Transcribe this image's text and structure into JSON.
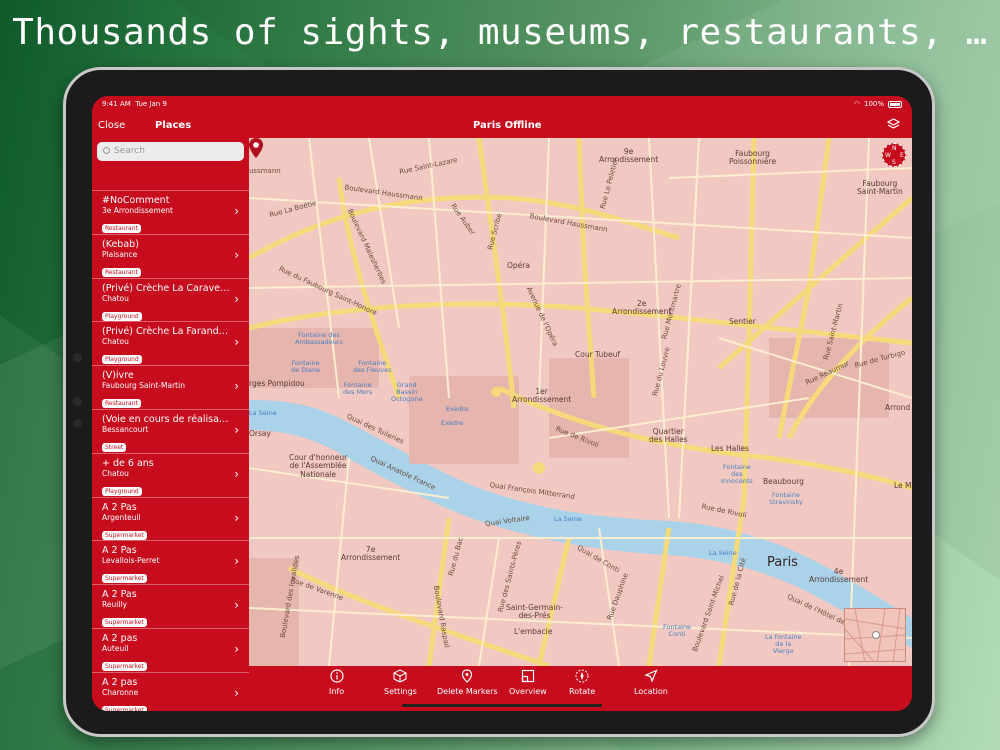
{
  "headline": "Thousands of sights, museums, restaurants, …",
  "status": {
    "time": "9:41 AM",
    "date": "Tue Jan 9",
    "battery": "100%"
  },
  "navbar": {
    "close": "Close",
    "places": "Places",
    "title": "Paris Offline"
  },
  "search": {
    "placeholder": "Search"
  },
  "places": [
    {
      "name": "#NoComment",
      "location": "3e Arrondissement",
      "tag": "Restaurant"
    },
    {
      "name": "(Kebab)",
      "location": "Plaisance",
      "tag": "Restaurant"
    },
    {
      "name": "(Privé) Crèche La Caravelle",
      "location": "Chatou",
      "tag": "Playground"
    },
    {
      "name": "(Privé) Crèche La Farand…",
      "location": "Chatou",
      "tag": "Playground"
    },
    {
      "name": "(V)ivre",
      "location": "Faubourg Saint-Martin",
      "tag": "Restaurant"
    },
    {
      "name": "(Voie en cours de réalisati…",
      "location": "Bessancourt",
      "tag": "Street"
    },
    {
      "name": "+ de 6 ans",
      "location": "Chatou",
      "tag": "Playground"
    },
    {
      "name": "A 2 Pas",
      "location": "Argenteuil",
      "tag": "Supermarket"
    },
    {
      "name": "A 2 Pas",
      "location": "Levallois-Perret",
      "tag": "Supermarket"
    },
    {
      "name": "A 2 Pas",
      "location": "Reuilly",
      "tag": "Supermarket"
    },
    {
      "name": "A 2 pas",
      "location": "Auteuil",
      "tag": "Supermarket"
    },
    {
      "name": "A 2 pas",
      "location": "Charonne",
      "tag": "Supermarket"
    }
  ],
  "map": {
    "labels": {
      "arr9": "9e\nArrondissement",
      "faubourg_poissonniere": "Faubourg\nPoissonnière",
      "faubourg_saint_martin": "Faubourg\nSaint-Martin",
      "opera": "Opéra",
      "arr2": "2e\nArrondissement",
      "sentier": "Sentier",
      "cour_tubeuf": "Cour Tubeuf",
      "arr1": "1er\nArrondissement",
      "quartier_halles": "Quartier\ndes Halles",
      "les_halles": "Les Halles",
      "beaubourg": "Beaubourg",
      "cour_honneur": "Cour d'honneur\nde l'Assemblée\nNationale",
      "arr7": "7e\nArrondissement",
      "saint_germain": "Saint-Germain-\ndes-Prés",
      "paris": "Paris",
      "arr4": "4e\nArrondissement",
      "lembacie": "L'embacie",
      "arrond": "Arrond",
      "le_m": "Le M",
      "orsay": "Orsay",
      "georges_pompidou": "rges Pompidou",
      "fontaine_ambassadeurs": "Fontaine des\nAmbassadeurs",
      "fontaine_diane": "Fontaine\nde Diane",
      "fontaine_fleuves": "Fontaine\ndes Fleuves",
      "fontaine_mers": "Fontaine\ndes Mers",
      "grand_bassin": "Grand\nBassin\nOctogone",
      "exedre1": "Exèdre",
      "exedre2": "Exèdre",
      "fontaine_innocents": "Fontaine\ndes\nInnocents",
      "fontaine_stravinsky": "Fontaine\nStravinsky",
      "fontaine_conti": "Fontaine\nConti",
      "fontaine_vierge": "La fontaine\nde la\nVierge",
      "seine1": "La Seine",
      "seine2": "La Seine",
      "seine3": "La Seine",
      "r_lazare": "Rue Saint-Lazare",
      "r_boetie": "Rue La Boétie",
      "b_haussmann": "Boulevard Haussmann",
      "b_haussmann2": "Boulevard Haussmann",
      "r_rivoli": "Rue de Rivoli",
      "r_rivoli2": "Rue de Rivoli",
      "r_tuileries": "Quai des Tuileries",
      "q_mitterrand": "Quai François Mitterrand",
      "q_voltaire": "Quai Voltaire",
      "q_conti": "Quai de Conti",
      "q_anatole": "Quai Anatole France",
      "r_varenne": "Rue de Varenne",
      "b_raspail": "Boulevard Raspail",
      "b_invalides": "Boulevard des Invalides",
      "r_turbigo": "Rue de Turbigo",
      "r_reaumur": "Rue Réaumur",
      "r_dauphine": "Rue Dauphine",
      "b_saint_michel": "Boulevard Saint-Michel",
      "r_saint_martin": "Rue Saint-Martin",
      "r_du_louvre": "Rue du Louvre",
      "r_faubourg_sh": "Rue du Faubourg Saint-Honoré",
      "av_opera": "Avenue de l'Opéra",
      "r_bac": "Rue du Bac",
      "b_malesherbes": "Boulevard Malesherbes",
      "r_auber": "Rue Auber",
      "r_scribe": "Rue Scribe",
      "r_peletier": "Rue Le Peletier",
      "r_st_peres": "Rue des Saints-Pères",
      "q_hotel_ville": "Quai de l'Hôtel de V",
      "r_montmartre": "Rue Montmartre",
      "r_cite": "Rue de la Cité",
      "haussmann_left": "ussmann"
    }
  },
  "toolbar": [
    {
      "label": "Info",
      "icon": "info-icon"
    },
    {
      "label": "Settings",
      "icon": "cube-icon"
    },
    {
      "label": "Delete Markers",
      "icon": "marker-icon"
    },
    {
      "label": "Overview",
      "icon": "overview-icon"
    },
    {
      "label": "Rotate",
      "icon": "rotate-icon"
    },
    {
      "label": "Location",
      "icon": "location-arrow-icon"
    }
  ],
  "colors": {
    "brand_red": "#c70c1e",
    "map_land": "#f2c9c2",
    "water": "#aad3ea",
    "road_major": "#f6d97a"
  }
}
